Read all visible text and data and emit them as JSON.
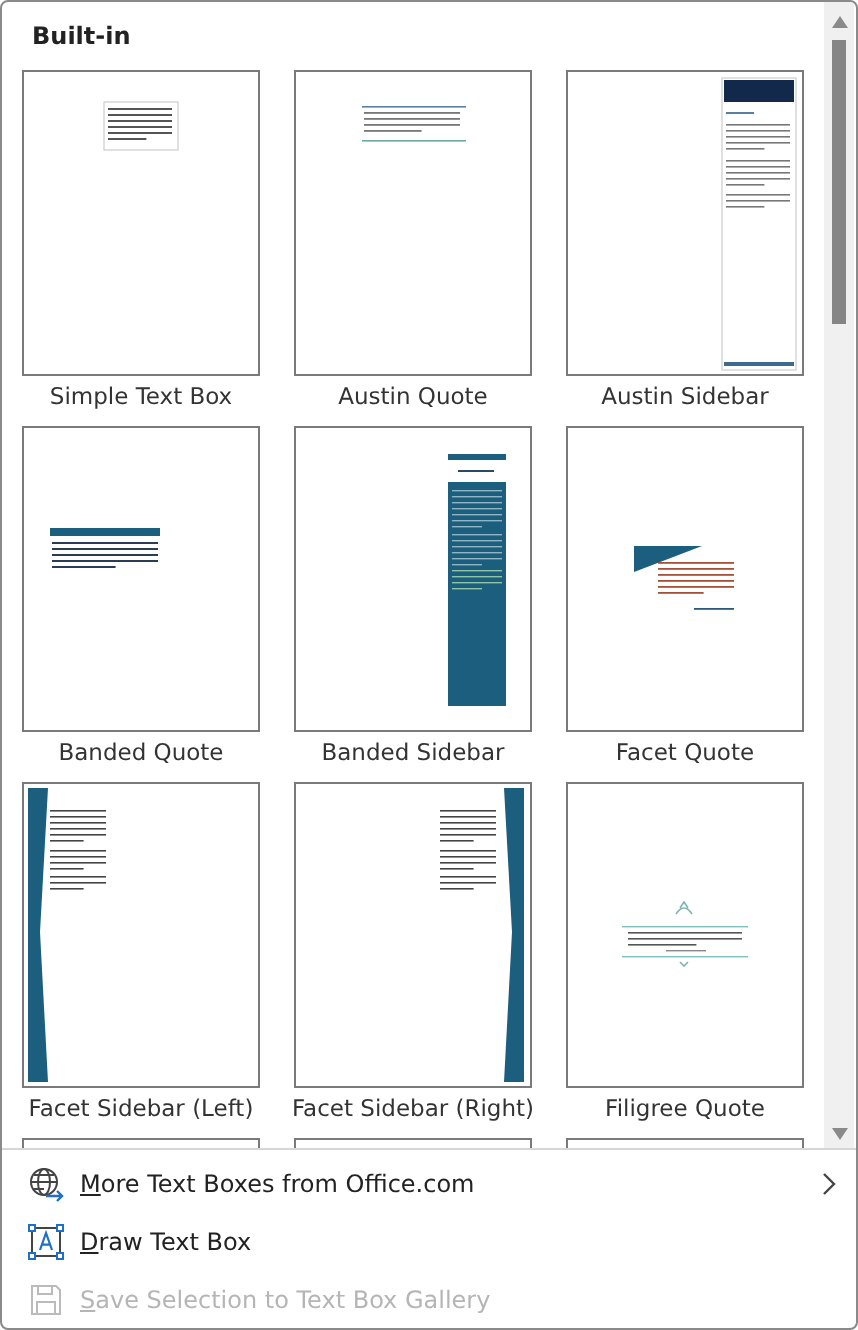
{
  "gallery": {
    "heading": "Built-in",
    "items": [
      {
        "label": "Simple Text Box",
        "kind": "simple"
      },
      {
        "label": "Austin Quote",
        "kind": "austin-quote"
      },
      {
        "label": "Austin Sidebar",
        "kind": "austin-sidebar"
      },
      {
        "label": "Banded Quote",
        "kind": "banded-quote"
      },
      {
        "label": "Banded Sidebar",
        "kind": "banded-sidebar"
      },
      {
        "label": "Facet Quote",
        "kind": "facet-quote"
      },
      {
        "label": "Facet Sidebar (Left)",
        "kind": "facet-left"
      },
      {
        "label": "Facet Sidebar (Right)",
        "kind": "facet-right"
      },
      {
        "label": "Filigree Quote",
        "kind": "filigree"
      },
      {
        "kind": "blank"
      },
      {
        "kind": "blank"
      },
      {
        "kind": "blank"
      }
    ]
  },
  "menu_items": [
    {
      "label": "More Text Boxes from Office.com",
      "kind": "globe",
      "submenu": true,
      "disabled": false
    },
    {
      "label": "Draw Text Box",
      "kind": "draw",
      "submenu": false,
      "disabled": false
    },
    {
      "label": "Save Selection to Text Box Gallery",
      "kind": "save",
      "submenu": false,
      "disabled": true
    }
  ]
}
